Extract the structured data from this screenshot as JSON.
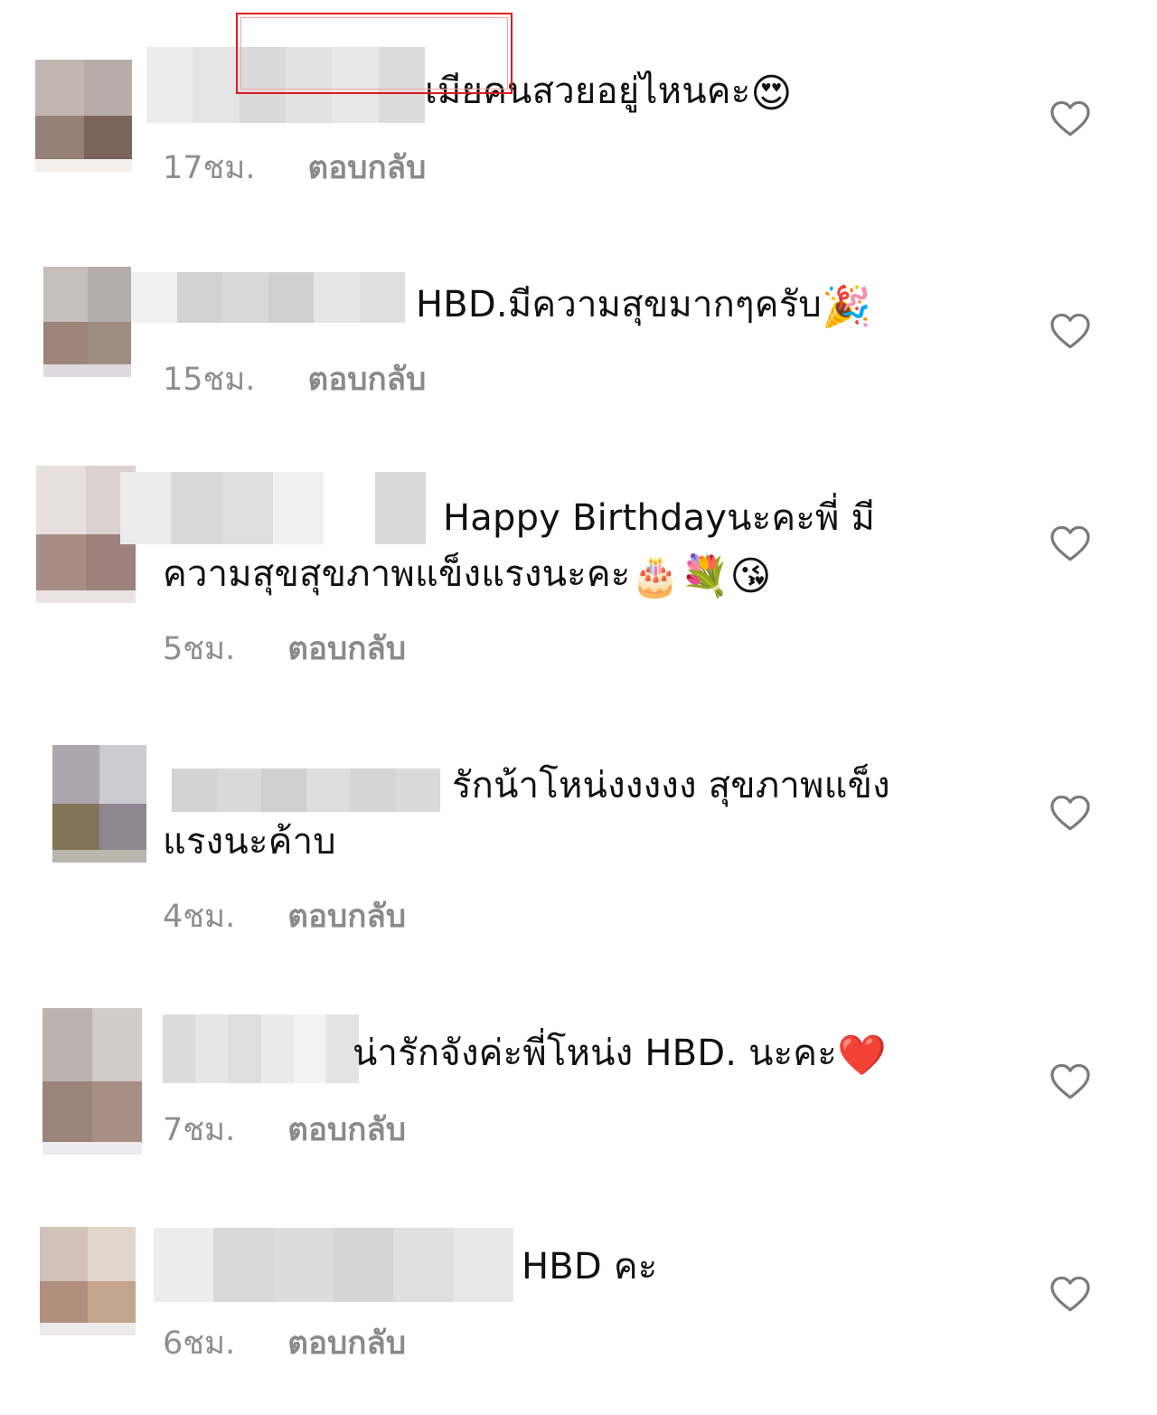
{
  "colors": {
    "text": "#111111",
    "meta": "#8e8e8e",
    "icon_stroke": "#7a7a7a",
    "highlight_box": "#e0191f"
  },
  "comments": [
    {
      "text": "เมียคนสวยอยู่ไหนคะ",
      "emojis": [
        "😍"
      ],
      "time": "17ชม.",
      "reply": "ตอบกลับ",
      "like_icon": "heart-outline-icon",
      "avatar_colors": [
        "#c2b6b0",
        "#b7aca7",
        "#958178",
        "#7a645c"
      ],
      "mask_colors": [
        "#ececec",
        "#e4e4e4",
        "#dadada",
        "#e2e2e2",
        "#e8e8e8",
        "#dcdcdc"
      ]
    },
    {
      "text": "HBD.มีความสุขมากๆครับ",
      "emojis": [
        "🎉"
      ],
      "time": "15ชม.",
      "reply": "ตอบกลับ",
      "like_icon": "heart-outline-icon",
      "avatar_colors": [
        "#c5bebb",
        "#b4adab",
        "#9c847b",
        "#a08d84"
      ],
      "mask_colors": [
        "#f0f0f0",
        "#d2d2d2",
        "#d8d8d8",
        "#cfcfcf",
        "#e6e6e6",
        "#dedede"
      ]
    },
    {
      "text": "Happy Birthdayนะคะพี่ มีความสุขสุขภาพแข็งแรงนะคะ",
      "emojis": [
        "🎂",
        "💐",
        "😘"
      ],
      "time": "5ชม.",
      "reply": "ตอบกลับ",
      "like_icon": "heart-outline-icon",
      "avatar_colors": [
        "#e7e0df",
        "#dcd2d1",
        "#a88c86",
        "#9c817c"
      ],
      "mask_colors": [
        "#ececec",
        "#d9d9d9",
        "#dedede",
        "#f0f0f0",
        "#ffffff",
        "#dadada"
      ]
    },
    {
      "text": "รักน้าโหน่งงงงง สุขภาพแข็งแรงนะค้าบ",
      "emojis": [],
      "time": "4ชม.",
      "reply": "ตอบกลับ",
      "like_icon": "heart-outline-icon",
      "avatar_colors": [
        "#aca6ae",
        "#cccbd0",
        "#837558",
        "#8e8690"
      ],
      "mask_colors": [
        "#d3d3d3",
        "#d9d9d9",
        "#cfcfcf",
        "#dddddd",
        "#d6d6d6",
        "#dadada"
      ]
    },
    {
      "text": "น่ารักจังค่ะพี่โหน่ง HBD. นะคะ",
      "emojis": [
        "❤️"
      ],
      "time": "7ชม.",
      "reply": "ตอบกลับ",
      "like_icon": "heart-outline-icon",
      "avatar_colors": [
        "#bcb2af",
        "#d2cbc8",
        "#9a847c",
        "#a78f86"
      ],
      "mask_colors": [
        "#dcdcdc",
        "#e6e6e6",
        "#dedede",
        "#eaeaea",
        "#f2f2f2",
        "#e3e3e3"
      ]
    },
    {
      "text": "HBD คะ",
      "emojis": [],
      "time": "6ชม.",
      "reply": "ตอบกลับ",
      "like_icon": "heart-outline-icon",
      "avatar_colors": [
        "#d2c2b9",
        "#e3d7cd",
        "#b08f7f",
        "#c3a48d"
      ],
      "mask_colors": [
        "#ececec",
        "#d8d8d8",
        "#dcdcdc",
        "#d6d6d6",
        "#e0e0e0",
        "#e8e8e8"
      ]
    }
  ]
}
